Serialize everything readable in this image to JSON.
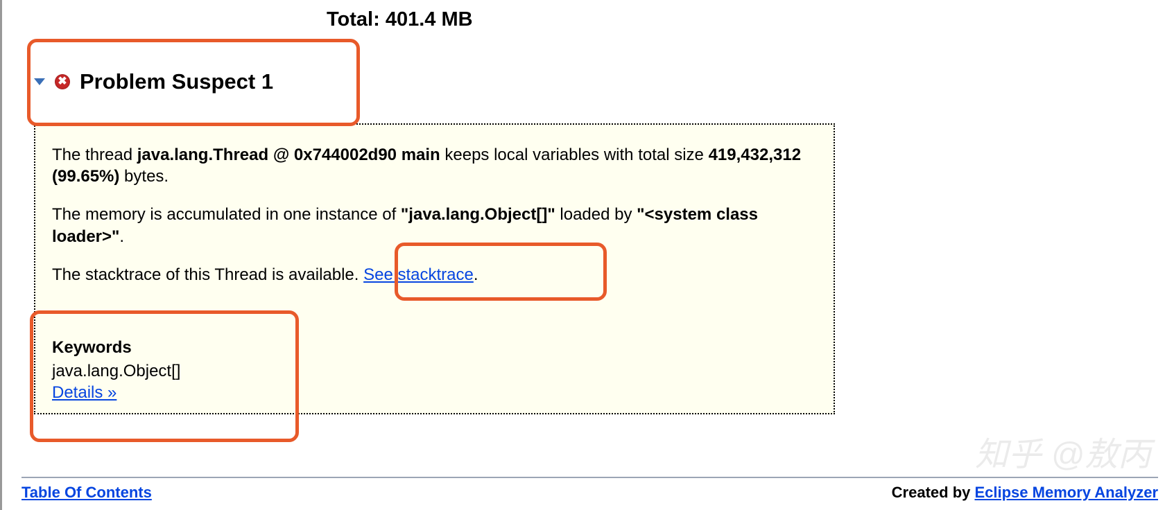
{
  "total_label": "Total: 401.4 MB",
  "suspect": {
    "title": "Problem Suspect 1",
    "para1_prefix": "The thread ",
    "para1_bold1": "java.lang.Thread @ 0x744002d90 main",
    "para1_mid": " keeps local variables with total size ",
    "para1_bold2": "419,432,312 (99.65%)",
    "para1_suffix": " bytes.",
    "para2_prefix": "The memory is accumulated in one instance of ",
    "para2_bold1": "\"java.lang.Object[]\"",
    "para2_mid": " loaded by ",
    "para2_bold2": "\"<system class loader>\"",
    "para2_suffix": ".",
    "para3_prefix": "The stacktrace of this Thread is available. ",
    "para3_link": "See stacktrace",
    "para3_suffix": ".",
    "keywords_heading": "Keywords",
    "keywords_value": "java.lang.Object[]",
    "details_link": "Details »"
  },
  "footer": {
    "toc": "Table Of Contents",
    "created_by": "Created by ",
    "analyzer_link": "Eclipse Memory Analyzer"
  },
  "watermark": "知乎 @敖丙"
}
